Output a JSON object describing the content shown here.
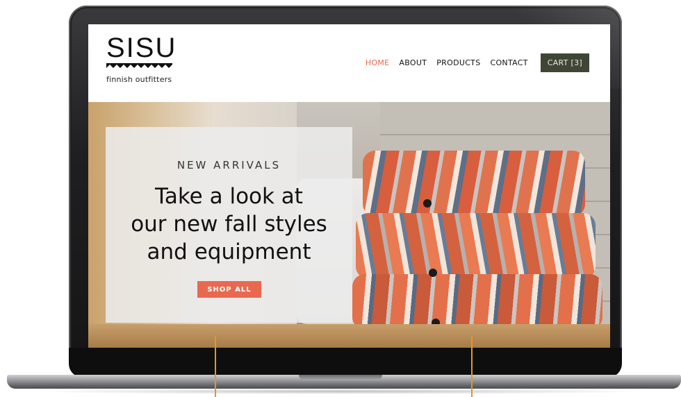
{
  "brand": {
    "name": "SISU",
    "tagline": "finnish outfitters"
  },
  "nav": {
    "items": [
      {
        "label": "HOME",
        "active": true
      },
      {
        "label": "ABOUT",
        "active": false
      },
      {
        "label": "PRODUCTS",
        "active": false
      },
      {
        "label": "CONTACT",
        "active": false
      }
    ],
    "cart_label": "CART [3]"
  },
  "hero": {
    "kicker": "NEW ARRIVALS",
    "headline_lines": [
      "Take a look at",
      "our new fall styles",
      "and equipment"
    ],
    "cta_label": "SHOP ALL"
  },
  "colors": {
    "accent": "#e8694f",
    "cart_bg": "#3f4635",
    "annotation_line": "#e7952c"
  }
}
